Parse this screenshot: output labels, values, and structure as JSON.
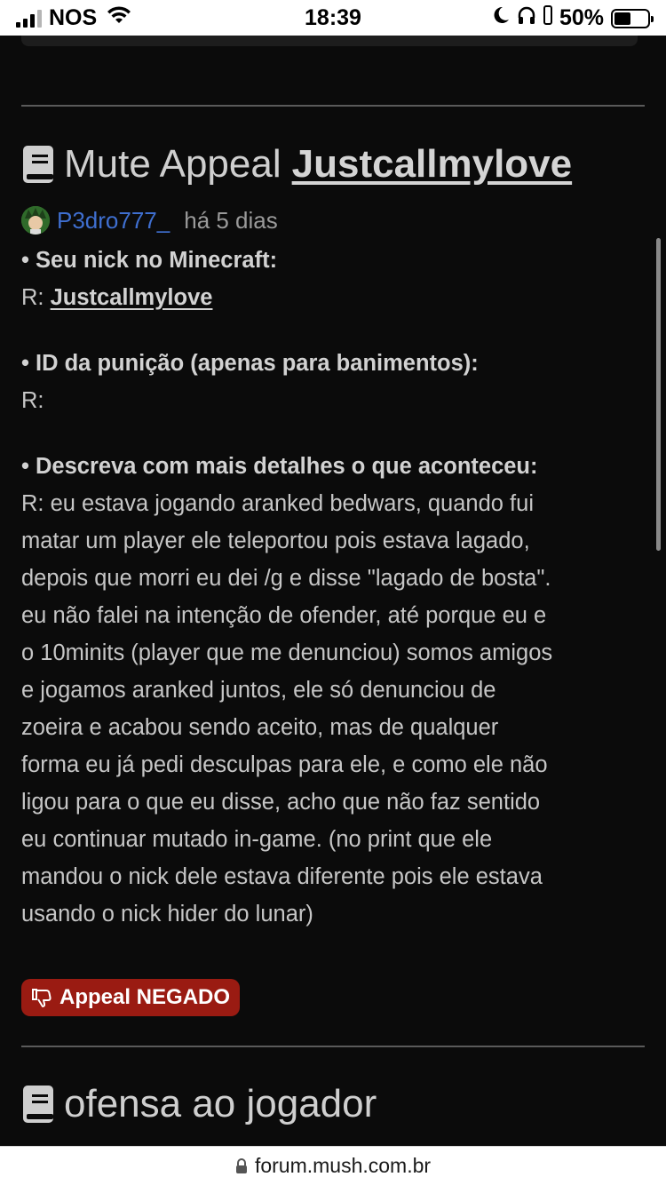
{
  "status_bar": {
    "carrier": "NOS",
    "time": "18:39",
    "battery": "50%"
  },
  "posts": [
    {
      "title": "Mute Appeal",
      "title_user": "Justcallmylove",
      "author": "P3dro777_",
      "time_ago": "há 5 dias",
      "q1": "• Seu nick no Minecraft:",
      "a1_prefix": "R:",
      "a1_value": "Justcallmylove",
      "q2": "• ID da punição (apenas para banimentos):",
      "a2": "R:",
      "q3": "• Descreva com mais detalhes o que aconteceu:",
      "a3_lines": [
        "R: eu estava jogando aranked bedwars, quando fui",
        "matar um player ele teleportou pois estava lagado,",
        "depois que morri eu dei /g e disse \"lagado de bosta\".",
        "eu não falei na intenção de ofender, até porque eu e",
        "o 10minits (player que me denunciou) somos amigos",
        "e jogamos aranked juntos, ele só denunciou de",
        "zoeira e acabou sendo aceito, mas de qualquer",
        "forma eu já pedi desculpas para ele, e como ele não",
        "ligou para o que eu disse, acho que não faz sentido",
        "eu continuar mutado in-game. (no print que ele",
        "mandou o nick dele estava diferente pois ele estava",
        "usando o nick hider do lunar)"
      ],
      "status_badge": "Appeal NEGADO",
      "status_color": "#9a1b12"
    },
    {
      "title": "ofensa ao jogador"
    }
  ],
  "url_bar": {
    "url": "forum.mush.com.br"
  }
}
